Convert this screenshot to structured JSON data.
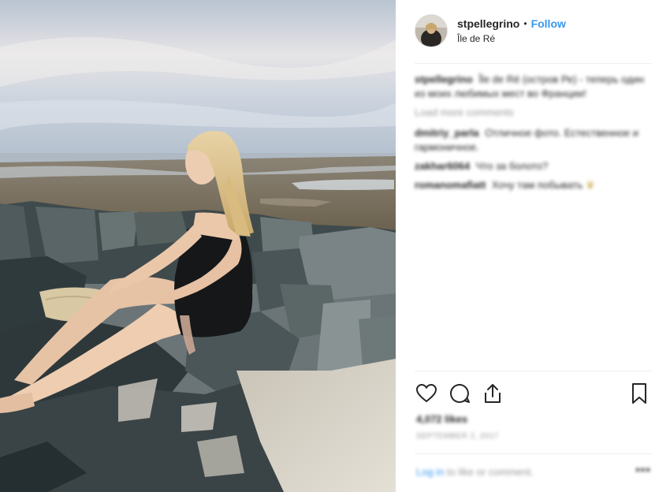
{
  "post": {
    "username": "stpellegrino",
    "follow_label": "Follow",
    "separator": "•",
    "location": "Île de Ré"
  },
  "comments": {
    "caption_user": "stpellegrino",
    "caption_text": "Île de Ré (остров Ре) - теперь один из моих любимых мест во Франции!",
    "load_more": "Load more comments",
    "items": [
      {
        "user": "dmitriy_parla",
        "text": "Отличное фото. Естественное и гармоничное."
      },
      {
        "user": "zakhar6064",
        "text": "Что за болото?"
      },
      {
        "user": "romanomafiatt",
        "text": "Хочу там побывать"
      }
    ],
    "emoji": "♛"
  },
  "stats": {
    "likes": "4,072 likes",
    "date": "September 2, 2017"
  },
  "footer": {
    "login_link": "Log in",
    "login_rest": "to like or comment.",
    "more": "•••"
  },
  "icons": [
    "heart-icon",
    "comment-icon",
    "share-icon",
    "bookmark-icon",
    "more-options-icon"
  ],
  "colors": {
    "accent": "#3897f0",
    "text": "#262626",
    "muted": "#999999",
    "divider": "#efefef"
  }
}
